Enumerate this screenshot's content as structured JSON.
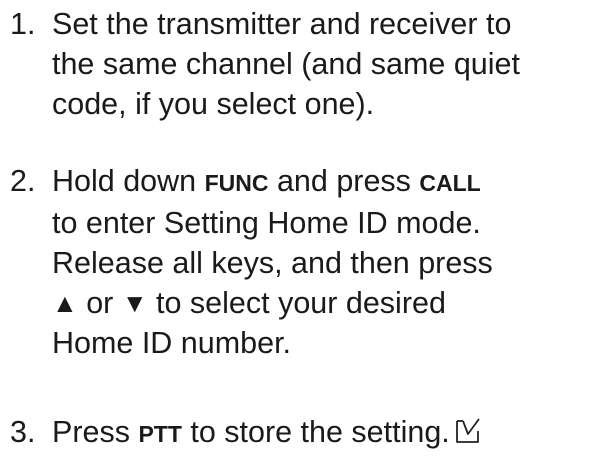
{
  "steps": [
    {
      "number": "1.",
      "lines": [
        "Set the transmitter and receiver to",
        "the same channel (and same quiet",
        "code, if you select one)."
      ]
    },
    {
      "number": "2.",
      "line1": {
        "pre": "Hold down ",
        "kw1": "FUNC",
        "mid": " and press ",
        "kw2": "CALL"
      },
      "line2": "to enter Setting Home ID mode.",
      "line3": "Release all keys, and then press",
      "line4": {
        "up": "▲",
        "or": " or ",
        "down": "▼",
        "post": " to select your desired"
      },
      "line5": "Home ID number."
    },
    {
      "number": "3.",
      "pre": "Press ",
      "kw": "PTT",
      "post": " to store the setting.",
      "end_icon": "check-mark-box-icon"
    }
  ]
}
